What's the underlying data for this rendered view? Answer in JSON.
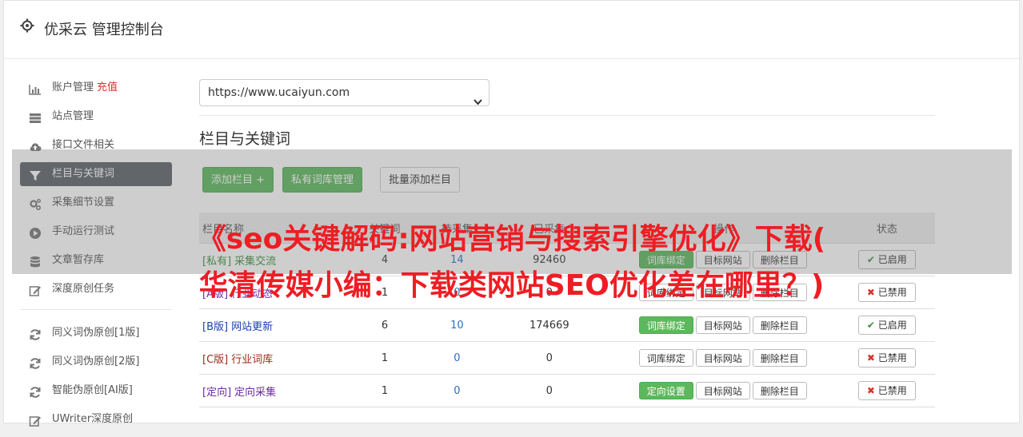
{
  "header": {
    "title": "优采云 管理控制台"
  },
  "sidebar": {
    "items": [
      {
        "label": "账户管理",
        "extra": "充值",
        "icon": "bar-chart-icon"
      },
      {
        "label": "站点管理",
        "icon": "server-icon"
      },
      {
        "label": "接口文件相关",
        "icon": "cloud-upload-icon"
      },
      {
        "label": "栏目与关键词",
        "icon": "filter-icon",
        "active": true
      },
      {
        "label": "采集细节设置",
        "icon": "cogs-icon"
      },
      {
        "label": "手动运行测试",
        "icon": "play-circle-icon"
      },
      {
        "label": "文章暂存库",
        "icon": "database-icon"
      },
      {
        "label": "深度原创任务",
        "icon": "edit-icon"
      }
    ],
    "items2": [
      {
        "label": "同义词伪原创[1版]",
        "icon": "refresh-icon"
      },
      {
        "label": "同义词伪原创[2版]",
        "icon": "refresh-icon"
      },
      {
        "label": "智能伪原创[AI版]",
        "icon": "refresh-icon"
      },
      {
        "label": "UWriter深度原创",
        "icon": "edit-icon"
      }
    ]
  },
  "main": {
    "site_select": {
      "value": "https://www.ucaiyun.com"
    },
    "section_title": "栏目与关键词",
    "buttons": {
      "add_column": "添加栏目 +",
      "private_lib": "私有词库管理",
      "batch_add": "批量添加栏目"
    },
    "table": {
      "headers": [
        "栏目名称",
        "关键词",
        "待采集",
        "已采集",
        "操作",
        "状态"
      ],
      "rows": [
        {
          "tag": "[私有]",
          "name": "采集交流",
          "color": "green",
          "keywords": "4",
          "pending": "14",
          "collected": "92460",
          "actions": [
            "词库绑定",
            "目标网站",
            "删除栏目"
          ],
          "first_green": true,
          "status": "已启用",
          "on": true
        },
        {
          "tag": "[A版]",
          "name": "行业动态",
          "color": "purple",
          "keywords": "1",
          "pending": "0",
          "collected": "0",
          "actions": [
            "词库绑定",
            "目标网站",
            "删除栏目"
          ],
          "first_green": false,
          "status": "已禁用",
          "on": false
        },
        {
          "tag": "[B版]",
          "name": "网站更新",
          "color": "blue",
          "keywords": "6",
          "pending": "10",
          "collected": "174669",
          "actions": [
            "词库绑定",
            "目标网站",
            "删除栏目"
          ],
          "first_green": true,
          "status": "已启用",
          "on": true
        },
        {
          "tag": "[C版]",
          "name": "行业词库",
          "color": "red",
          "keywords": "1",
          "pending": "0",
          "collected": "0",
          "actions": [
            "词库绑定",
            "目标网站",
            "删除栏目"
          ],
          "first_green": false,
          "status": "已禁用",
          "on": false
        },
        {
          "tag": "[定向]",
          "name": "定向采集",
          "color": "purple",
          "keywords": "1",
          "pending": "0",
          "collected": "0",
          "actions": [
            "定向设置",
            "目标网站",
            "删除栏目"
          ],
          "first_green": true,
          "status": "已禁用",
          "on": false
        }
      ]
    }
  },
  "overlay": {
    "line1": "《seo关键解码:网站营销与搜索引擎优化》下载(",
    "line2": "华清传媒小编：下载类网站SEO优化差在哪里？)"
  },
  "colors": {
    "accent": "#5cb85c",
    "active_nav": "#5b6066",
    "overlay_text": "#ee1d24"
  }
}
